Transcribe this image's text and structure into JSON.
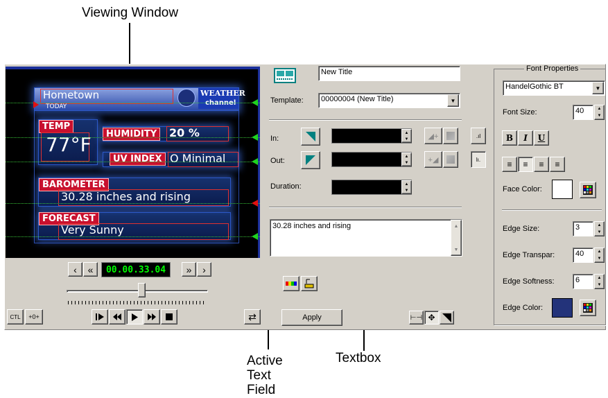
{
  "callouts": {
    "viewing_window": "Viewing Window",
    "active_text_field": [
      "Active",
      "Text",
      "Field"
    ],
    "textbox": "Textbox"
  },
  "preview": {
    "hometown": "Hometown",
    "today": "TODAY",
    "logo_top": "WEATHER",
    "logo_bottom": "channel",
    "temp_label": "TEMP",
    "temp_value": "77°F",
    "humidity_label": "HUMIDITY",
    "humidity_value": "20 %",
    "uv_label": "UV INDEX",
    "uv_value": "O Minimal",
    "barometer_label": "BAROMETER",
    "barometer_value": "30.28 inches and rising",
    "forecast_label": "FORECAST",
    "forecast_value": "Very Sunny"
  },
  "transport": {
    "timecode": "00.00.33.04",
    "ctl_label": "CTL",
    "offset_label": "+0+",
    "slider_position": 0.53
  },
  "title_settings": {
    "title_value": "New Title",
    "template_label": "Template:",
    "template_value": "00000004 (New Title)",
    "in_label": "In:",
    "out_label": "Out:",
    "duration_label": "Duration:",
    "textbox_value": "30.28 inches and rising",
    "apply_label": "Apply"
  },
  "font_properties": {
    "group_title": "Font Properties",
    "font_family": "HandelGothic BT",
    "font_size_label": "Font Size:",
    "font_size": "40",
    "bold": "B",
    "italic": "I",
    "underline": "U",
    "face_color_label": "Face Color:",
    "face_color": "#ffffff",
    "edge_size_label": "Edge Size:",
    "edge_size": "3",
    "edge_transpar_label": "Edge Transpar:",
    "edge_transpar": "40",
    "edge_softness_label": "Edge Softness:",
    "edge_softness": "6",
    "edge_color_label": "Edge Color:",
    "edge_color": "#23337a"
  },
  "colors": {
    "panel": "#d4d0c8",
    "timecode_fg": "#00ff00",
    "accent_green": "#008080"
  }
}
